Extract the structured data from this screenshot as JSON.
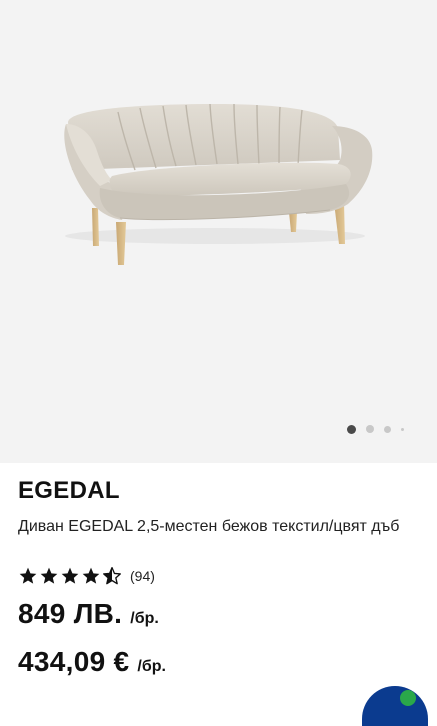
{
  "gallery": {
    "image_alt": "Диван EGEDAL",
    "slide_count": 4,
    "active_slide": 1
  },
  "product": {
    "brand": "EGEDAL",
    "description": "Диван EGEDAL 2,5-местен бежов текстил/цвят дъб",
    "rating": 4.5,
    "reviews_label": "(94)"
  },
  "prices": {
    "bgn_value": "849 ЛВ.",
    "bgn_unit": "/бр.",
    "eur_value": "434,09 €",
    "eur_unit": "/бр."
  },
  "colors": {
    "sofa": "#d9d4cb",
    "legs": "#d6b888",
    "badge_blue": "#0b3b8f",
    "badge_green": "#2aa84a"
  }
}
